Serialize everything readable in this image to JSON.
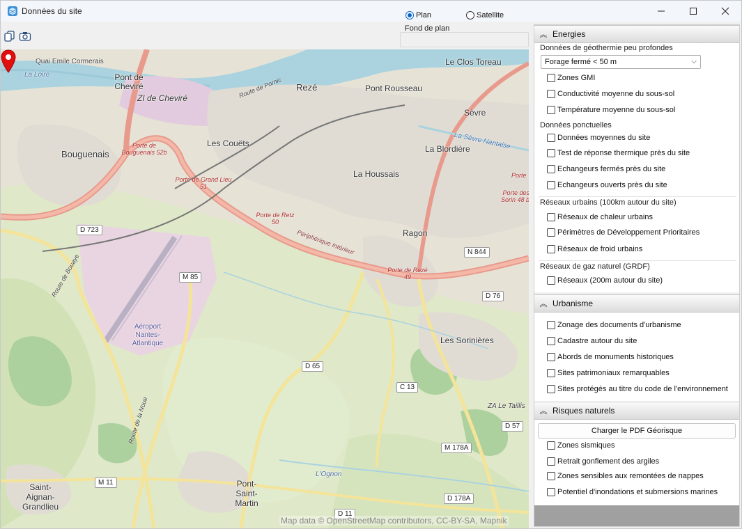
{
  "window": {
    "title": "Données du site",
    "icon": "cube-icon",
    "controls": {
      "minimize": "minimize-icon",
      "maximize": "maximize-icon",
      "close": "close-icon"
    }
  },
  "toolbar": {
    "tools": [
      "layers-icon",
      "camera-icon"
    ]
  },
  "basemap": {
    "label": "Fond de plan",
    "options": [
      "Plan",
      "Satellite"
    ],
    "selected": "Plan"
  },
  "map": {
    "attribution": "Map data © OpenStreetMap contributors, CC-BY-SA, Mapnik",
    "marker": "map-pin-icon",
    "places": [
      "Quai Emile Cormerais",
      "La Loire",
      "Pont de Cheviré",
      "ZI de Cheviré",
      "Rezé",
      "Pont Rousseau",
      "Le Clos Toreau",
      "Sèvre",
      "Bouguenais",
      "Les Couëts",
      "La Blordière",
      "La Houssais",
      "Ragon",
      "Aéroport Nantes-Atlantique",
      "Les Sorinières",
      "ZA Le Taillis",
      "Saint-Aignan-Grandlieu",
      "Pont-Saint-Martin",
      "L'Ognon",
      "La Sèvre Nantaise"
    ],
    "road_labels": [
      "Porte de Bouguenais 52b",
      "Porte de Grand Lieu 51",
      "Porte de Retz 50",
      "Périphérique Intérieur",
      "Porte de Rezé 49",
      "Porte des Sorin 48 b",
      "Porte",
      "Route de Bouaye",
      "Route de la Noue",
      "Route de Pornic"
    ],
    "shields": [
      "D 723",
      "M 85",
      "N 844",
      "D 76",
      "D 65",
      "C 13",
      "D 57",
      "M 178A",
      "M 11",
      "D 178A",
      "D 11"
    ]
  },
  "panel": {
    "sections": [
      {
        "title": "Energies",
        "groups": [
          {
            "title": "Données de géothermie peu profondes",
            "combo": "Forage fermé < 50 m",
            "items": [
              "Zones GMI",
              "Conductivité moyenne du sous-sol",
              "Température moyenne du sous-sol"
            ]
          },
          {
            "title": "Données ponctuelles",
            "items": [
              "Données moyennes du site",
              "Test de réponse thermique près du site",
              "Echangeurs fermés près du site",
              "Echangeurs ouverts près du site"
            ]
          },
          {
            "title": "Réseaux urbains (100km autour du site)",
            "items": [
              "Réseaux de chaleur urbains",
              "Périmètres de Développement Prioritaires",
              "Réseaux de froid urbains"
            ]
          },
          {
            "title": "Réseaux de gaz naturel (GRDF)",
            "items": [
              "Réseaux (200m autour du site)"
            ]
          }
        ]
      },
      {
        "title": "Urbanisme",
        "items": [
          "Zonage des documents d'urbanisme",
          "Cadastre autour du site",
          "Abords de monuments historiques",
          "Sites patrimoniaux remarquables",
          "Sites protégés au titre du code de l'environnement"
        ]
      },
      {
        "title": "Risques naturels",
        "button": "Charger le PDF Géorisque",
        "items": [
          "Zones sismiques",
          "Retrait gonflement des argiles",
          "Zones sensibles aux remontées de nappes",
          "Potentiel d'inondations et submersions marines"
        ]
      }
    ]
  }
}
